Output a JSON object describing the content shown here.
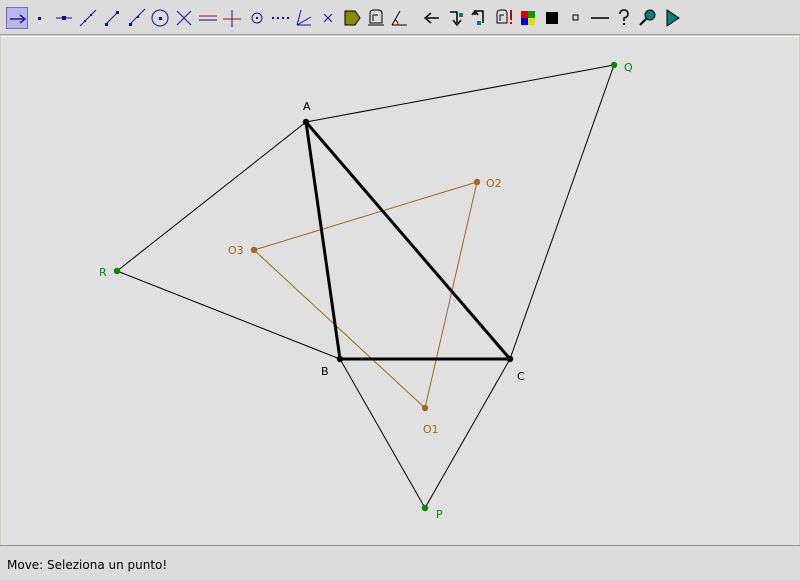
{
  "toolbar": {
    "tools": [
      {
        "name": "move-tool-icon",
        "active": true
      },
      {
        "name": "point-tool-icon"
      },
      {
        "name": "point-on-line-tool-icon"
      },
      {
        "name": "line-tool-icon"
      },
      {
        "name": "segment-tool-icon"
      },
      {
        "name": "ray-tool-icon"
      },
      {
        "name": "circle-tool-icon"
      },
      {
        "name": "intersection-tool-icon"
      },
      {
        "name": "parallel-tool-icon"
      },
      {
        "name": "perpendicular-tool-icon"
      },
      {
        "name": "midpoint-tool-icon"
      },
      {
        "name": "dotted-line-tool-icon"
      },
      {
        "name": "angle-bisector-tool-icon"
      },
      {
        "name": "delete-tool-icon"
      },
      {
        "name": "fill-tool-icon"
      },
      {
        "name": "measure-tool-icon"
      },
      {
        "name": "angle-measure-tool-icon"
      },
      {
        "name": "undo-icon"
      },
      {
        "name": "step-down-icon"
      },
      {
        "name": "step-back-icon"
      },
      {
        "name": "check-icon"
      },
      {
        "name": "color-palette-icon"
      },
      {
        "name": "filled-square-icon"
      },
      {
        "name": "hollow-square-icon"
      },
      {
        "name": "thin-line-icon"
      },
      {
        "name": "help-icon"
      },
      {
        "name": "zoom-icon"
      },
      {
        "name": "play-icon"
      }
    ]
  },
  "colors": {
    "triangle": "#000000",
    "construction": "#000000",
    "outer_points": "#008a00",
    "inner_triangle": "#a06818"
  },
  "points": {
    "A": {
      "label": "A"
    },
    "B": {
      "label": "B"
    },
    "C": {
      "label": "C"
    },
    "P": {
      "label": "P"
    },
    "Q": {
      "label": "Q"
    },
    "R": {
      "label": "R"
    },
    "O1": {
      "label": "O1"
    },
    "O2": {
      "label": "O2"
    },
    "O3": {
      "label": "O3"
    }
  },
  "status": {
    "text": "Move: Seleziona un punto!"
  }
}
